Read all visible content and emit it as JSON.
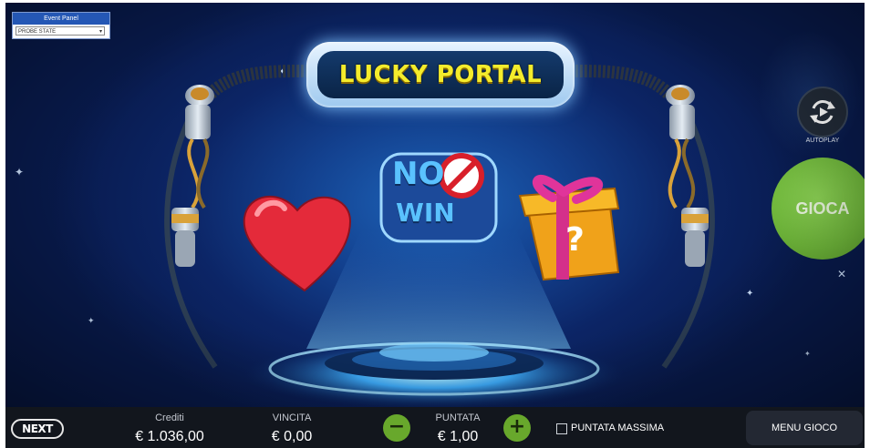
{
  "dev_panel": {
    "title": "Event Panel",
    "selected": "PROBE STATE"
  },
  "game": {
    "title": "LUCKY PORTAL",
    "symbols": [
      "heart",
      "no-win",
      "mystery-gift"
    ],
    "no_win_line1": "NO",
    "no_win_line2": "WIN",
    "gift_mark": "?"
  },
  "controls": {
    "autoplay_label": "AUTOPLAY",
    "play_label": "GIOCA"
  },
  "bottom_bar": {
    "logo": "NEXT",
    "credits_label": "Crediti",
    "credits_value": "€ 1.036,00",
    "win_label": "VINCITA",
    "win_value": "€ 0,00",
    "minus": "−",
    "bet_label": "PUNTATA",
    "bet_value": "€ 1,00",
    "plus": "+",
    "max_bet_label": "PUNTATA MASSIMA",
    "max_bet_checked": false,
    "menu_label": "MENU GIOCO"
  },
  "colors": {
    "play_green": "#6fb73a",
    "title_yellow": "#f4ec2c",
    "bar_bg": "#12161d"
  }
}
